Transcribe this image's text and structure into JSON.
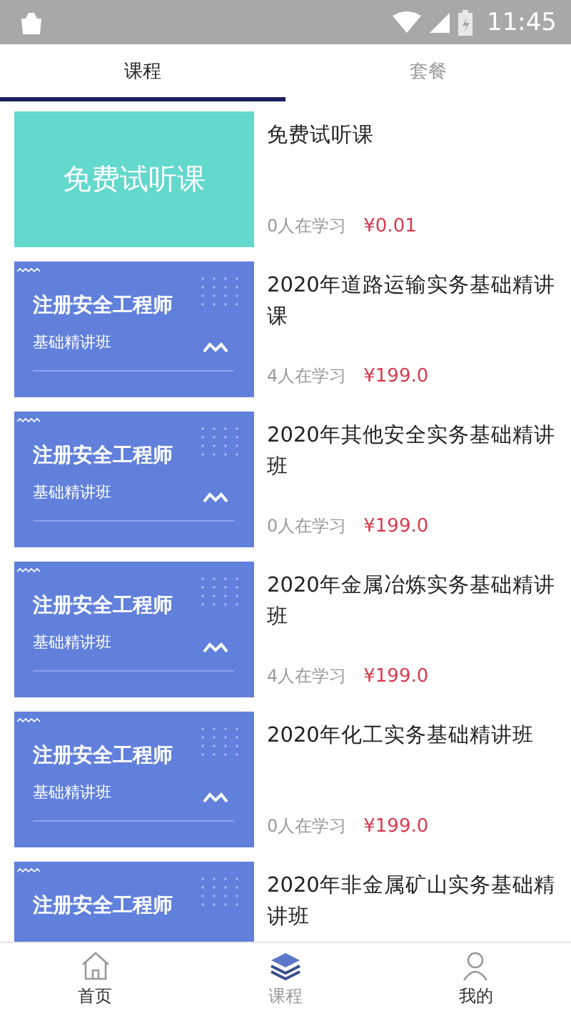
{
  "status_bar": {
    "time": "11:45"
  },
  "tabs": [
    {
      "label": "课程",
      "selected": true
    },
    {
      "label": "套餐",
      "selected": false
    }
  ],
  "courses": [
    {
      "kind": "plain",
      "cover_title": "免费试听课",
      "title": "免费试听课",
      "learners": "0人在学习",
      "price": "¥0.01"
    },
    {
      "kind": "banner",
      "cover_title": "注册安全工程师",
      "cover_subtitle": "基础精讲班",
      "title": "2020年道路运输实务基础精讲课",
      "learners": "4人在学习",
      "price": "¥199.0"
    },
    {
      "kind": "banner",
      "cover_title": "注册安全工程师",
      "cover_subtitle": "基础精讲班",
      "title": "2020年其他安全实务基础精讲班",
      "learners": "0人在学习",
      "price": "¥199.0"
    },
    {
      "kind": "banner",
      "cover_title": "注册安全工程师",
      "cover_subtitle": "基础精讲班",
      "title": "2020年金属冶炼实务基础精讲班",
      "learners": "4人在学习",
      "price": "¥199.0"
    },
    {
      "kind": "banner",
      "cover_title": "注册安全工程师",
      "cover_subtitle": "基础精讲班",
      "title": "2020年化工实务基础精讲班",
      "learners": "0人在学习",
      "price": "¥199.0"
    },
    {
      "kind": "banner",
      "cover_title": "注册安全工程师",
      "title": "2020年非金属矿山实务基础精讲班"
    }
  ],
  "bottom_nav": [
    {
      "label": "首页",
      "kind": "home",
      "selected": false
    },
    {
      "label": "课程",
      "kind": "layers",
      "selected": true
    },
    {
      "label": "我的",
      "kind": "person",
      "selected": false
    }
  ]
}
